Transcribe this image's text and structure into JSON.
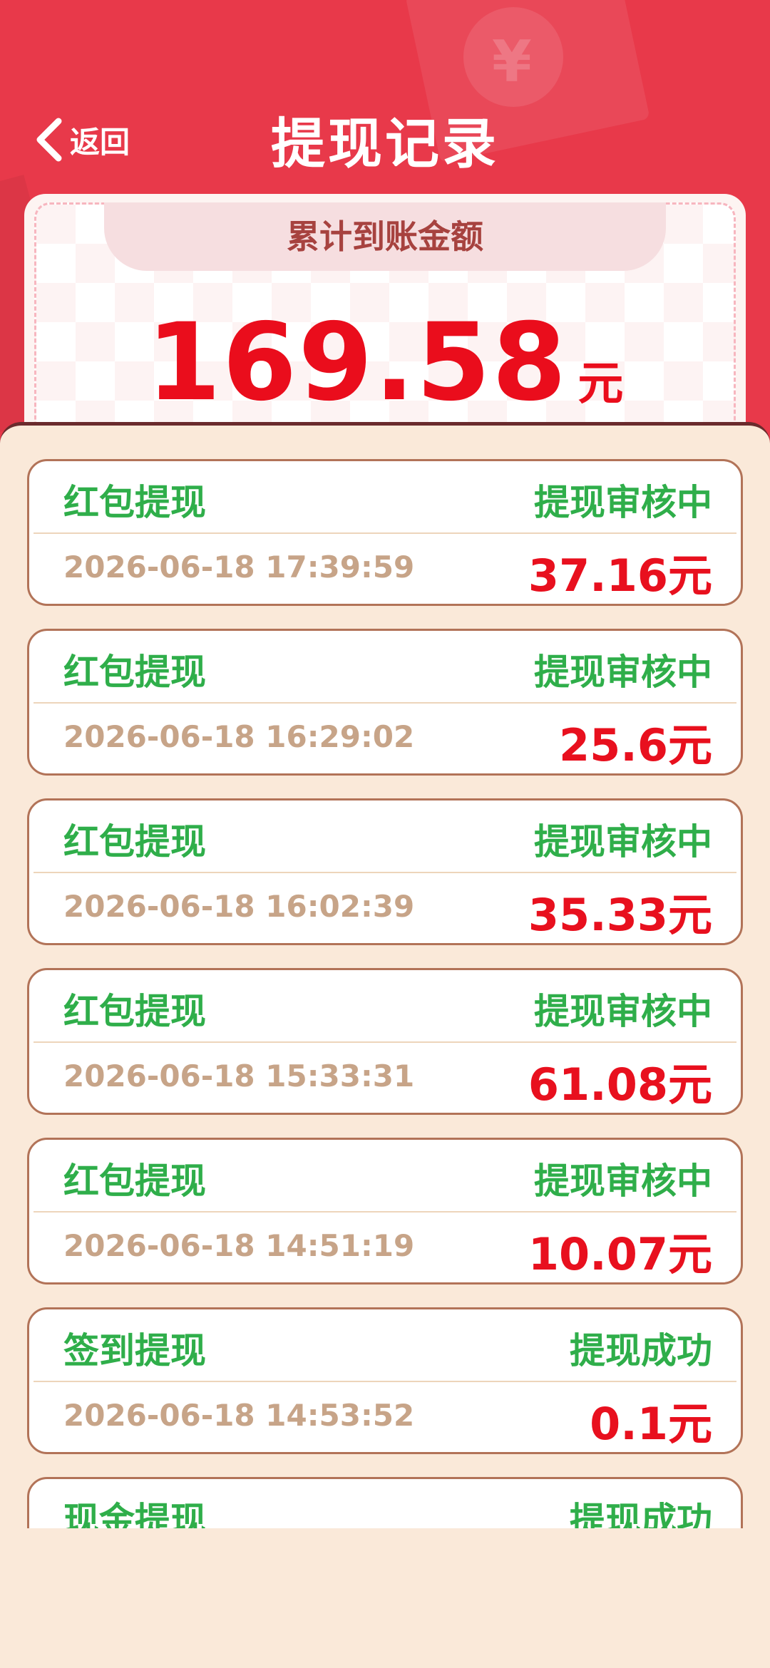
{
  "header": {
    "back_label": "返回",
    "title": "提现记录",
    "deco_glyph": "¥"
  },
  "summary": {
    "label": "累计到账金额",
    "amount": "169.58",
    "unit": "元"
  },
  "records": [
    {
      "type": "红包提现",
      "status": "提现审核中",
      "time": "2026-06-18 17:39:59",
      "amount": "37.16元"
    },
    {
      "type": "红包提现",
      "status": "提现审核中",
      "time": "2026-06-18 16:29:02",
      "amount": "25.6元"
    },
    {
      "type": "红包提现",
      "status": "提现审核中",
      "time": "2026-06-18 16:02:39",
      "amount": "35.33元"
    },
    {
      "type": "红包提现",
      "status": "提现审核中",
      "time": "2026-06-18 15:33:31",
      "amount": "61.08元"
    },
    {
      "type": "红包提现",
      "status": "提现审核中",
      "time": "2026-06-18 14:51:19",
      "amount": "10.07元"
    },
    {
      "type": "签到提现",
      "status": "提现成功",
      "time": "2026-06-18 14:53:52",
      "amount": "0.1元"
    },
    {
      "type": "现金提现",
      "status": "提现成功",
      "time": "",
      "amount": ""
    }
  ],
  "colors": {
    "header_red": "#e8394a",
    "amount_red": "#e8101e",
    "status_green": "#2fae4a",
    "time_tan": "#c7a488",
    "card_border": "#b27358",
    "panel_bg": "#fae9d9"
  },
  "icons": {
    "back": "chevron-left-icon",
    "decoration": "red-envelope-coin-icon"
  }
}
